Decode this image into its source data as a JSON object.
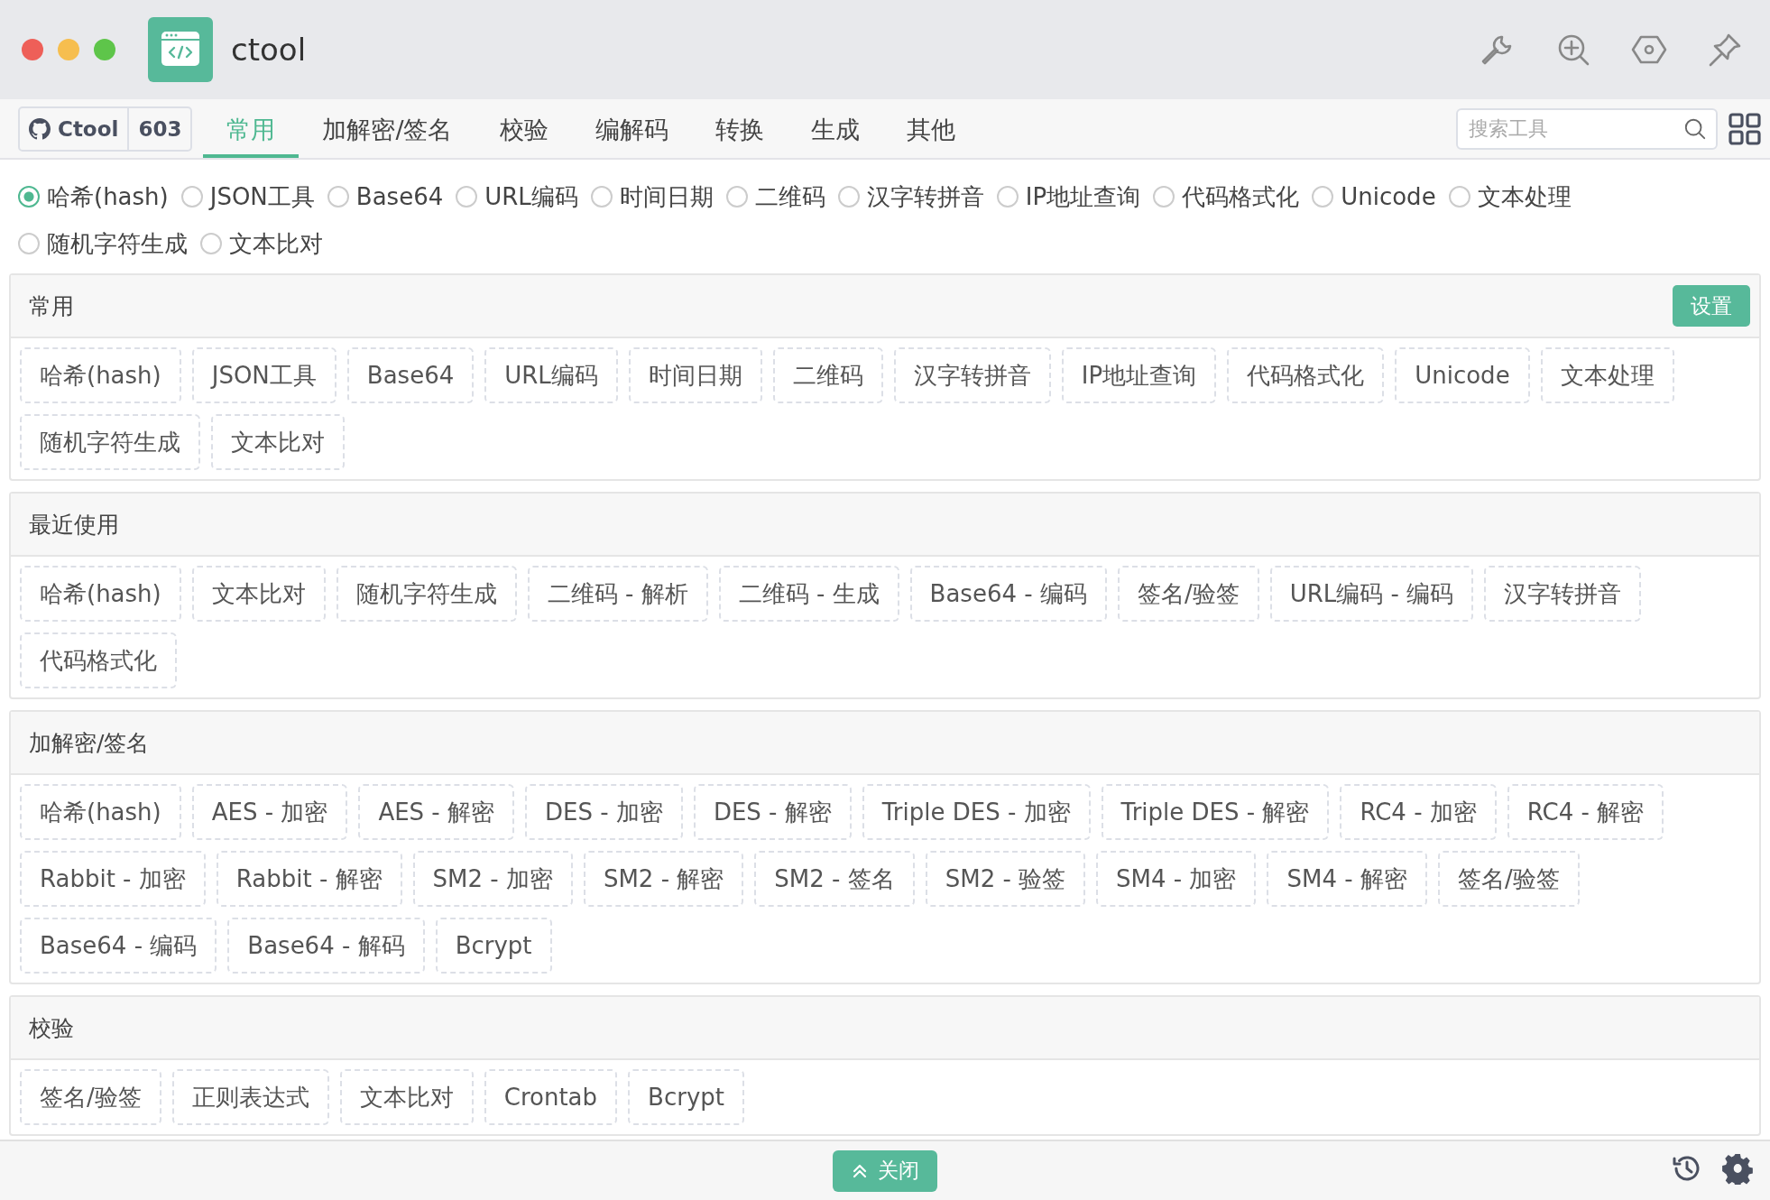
{
  "window": {
    "title": "ctool"
  },
  "github_badge": {
    "label": "Ctool",
    "count": "603"
  },
  "tabs": [
    {
      "label": "常用",
      "selected": true
    },
    {
      "label": "加解密/签名",
      "selected": false
    },
    {
      "label": "校验",
      "selected": false
    },
    {
      "label": "编解码",
      "selected": false
    },
    {
      "label": "转换",
      "selected": false
    },
    {
      "label": "生成",
      "selected": false
    },
    {
      "label": "其他",
      "selected": false
    }
  ],
  "search": {
    "placeholder": "搜索工具"
  },
  "categories": [
    {
      "label": "哈希(hash)",
      "selected": true
    },
    {
      "label": "JSON工具",
      "selected": false
    },
    {
      "label": "Base64",
      "selected": false
    },
    {
      "label": "URL编码",
      "selected": false
    },
    {
      "label": "时间日期",
      "selected": false
    },
    {
      "label": "二维码",
      "selected": false
    },
    {
      "label": "汉字转拼音",
      "selected": false
    },
    {
      "label": "IP地址查询",
      "selected": false
    },
    {
      "label": "代码格式化",
      "selected": false
    },
    {
      "label": "Unicode",
      "selected": false
    },
    {
      "label": "文本处理",
      "selected": false
    },
    {
      "label": "随机字符生成",
      "selected": false
    },
    {
      "label": "文本比对",
      "selected": false
    }
  ],
  "sections": [
    {
      "title": "常用",
      "action": "设置",
      "tools": [
        "哈希(hash)",
        "JSON工具",
        "Base64",
        "URL编码",
        "时间日期",
        "二维码",
        "汉字转拼音",
        "IP地址查询",
        "代码格式化",
        "Unicode",
        "文本处理",
        "随机字符生成",
        "文本比对"
      ]
    },
    {
      "title": "最近使用",
      "tools": [
        "哈希(hash)",
        "文本比对",
        "随机字符生成",
        "二维码 - 解析",
        "二维码 - 生成",
        "Base64 - 编码",
        "签名/验签",
        "URL编码 - 编码",
        "汉字转拼音",
        "代码格式化"
      ]
    },
    {
      "title": "加解密/签名",
      "tools": [
        "哈希(hash)",
        "AES - 加密",
        "AES - 解密",
        "DES - 加密",
        "DES - 解密",
        "Triple DES - 加密",
        "Triple DES - 解密",
        "RC4 - 加密",
        "RC4 - 解密",
        "Rabbit - 加密",
        "Rabbit - 解密",
        "SM2 - 加密",
        "SM2 - 解密",
        "SM2 - 签名",
        "SM2 - 验签",
        "SM4 - 加密",
        "SM4 - 解密",
        "签名/验签",
        "Base64 - 编码",
        "Base64 - 解码",
        "Bcrypt"
      ]
    },
    {
      "title": "校验",
      "tools": [
        "签名/验签",
        "正则表达式",
        "文本比对",
        "Crontab",
        "Bcrypt"
      ]
    }
  ],
  "footer": {
    "close_button": "关闭"
  }
}
